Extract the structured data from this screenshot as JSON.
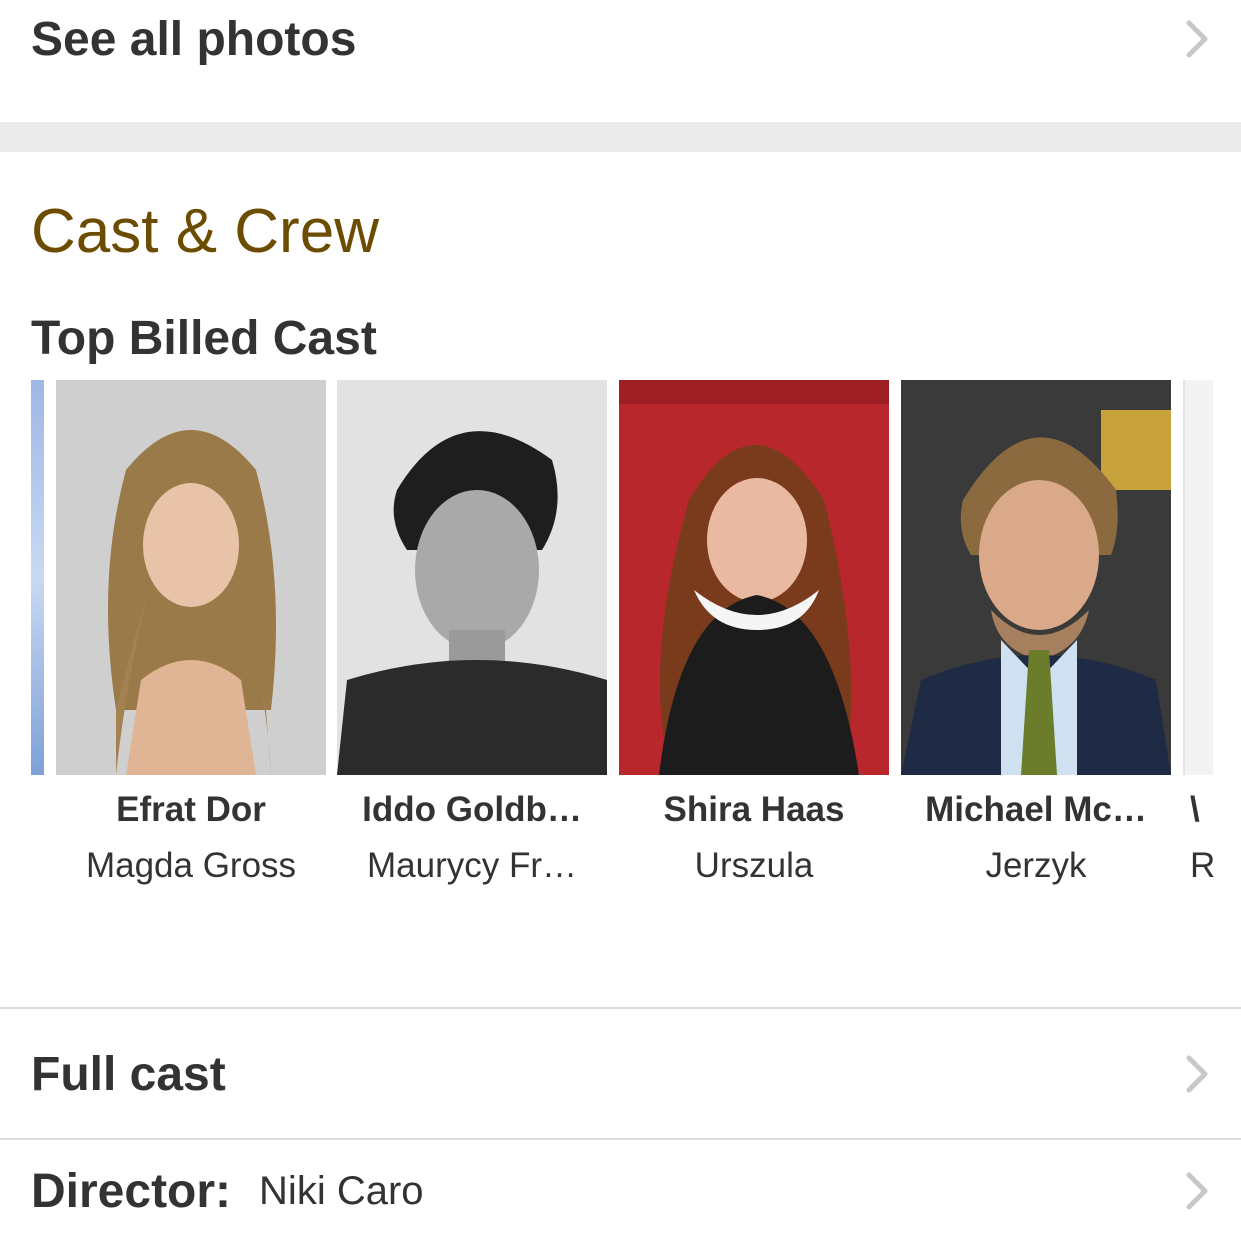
{
  "see_all": {
    "label": "See all photos"
  },
  "cast_crew": {
    "title": "Cast & Crew",
    "subtitle": "Top Billed Cast",
    "cast": [
      {
        "name": "Efrat Dor",
        "role": "Magda Gross",
        "photo_bg": "#cfcfd0"
      },
      {
        "name": "Iddo Goldb…",
        "role": "Maurycy Fr…",
        "photo_bg": "#d9d9d9"
      },
      {
        "name": "Shira Haas",
        "role": "Urszula",
        "photo_bg": "#b8272c"
      },
      {
        "name": "Michael Mc…",
        "role": "Jerzyk",
        "photo_bg": "#3a3a3a"
      }
    ],
    "next_card_partial": {
      "name": "\\",
      "role": "R"
    }
  },
  "full_cast": {
    "label": "Full cast"
  },
  "director": {
    "label": "Director:",
    "value": "Niki Caro"
  },
  "icons": {
    "chevron": "chevron-right-icon"
  },
  "colors": {
    "section_title": "#6b4c00",
    "band": "#ebebeb",
    "divider": "#dcdcdc",
    "chevron": "#c7c7cc"
  }
}
